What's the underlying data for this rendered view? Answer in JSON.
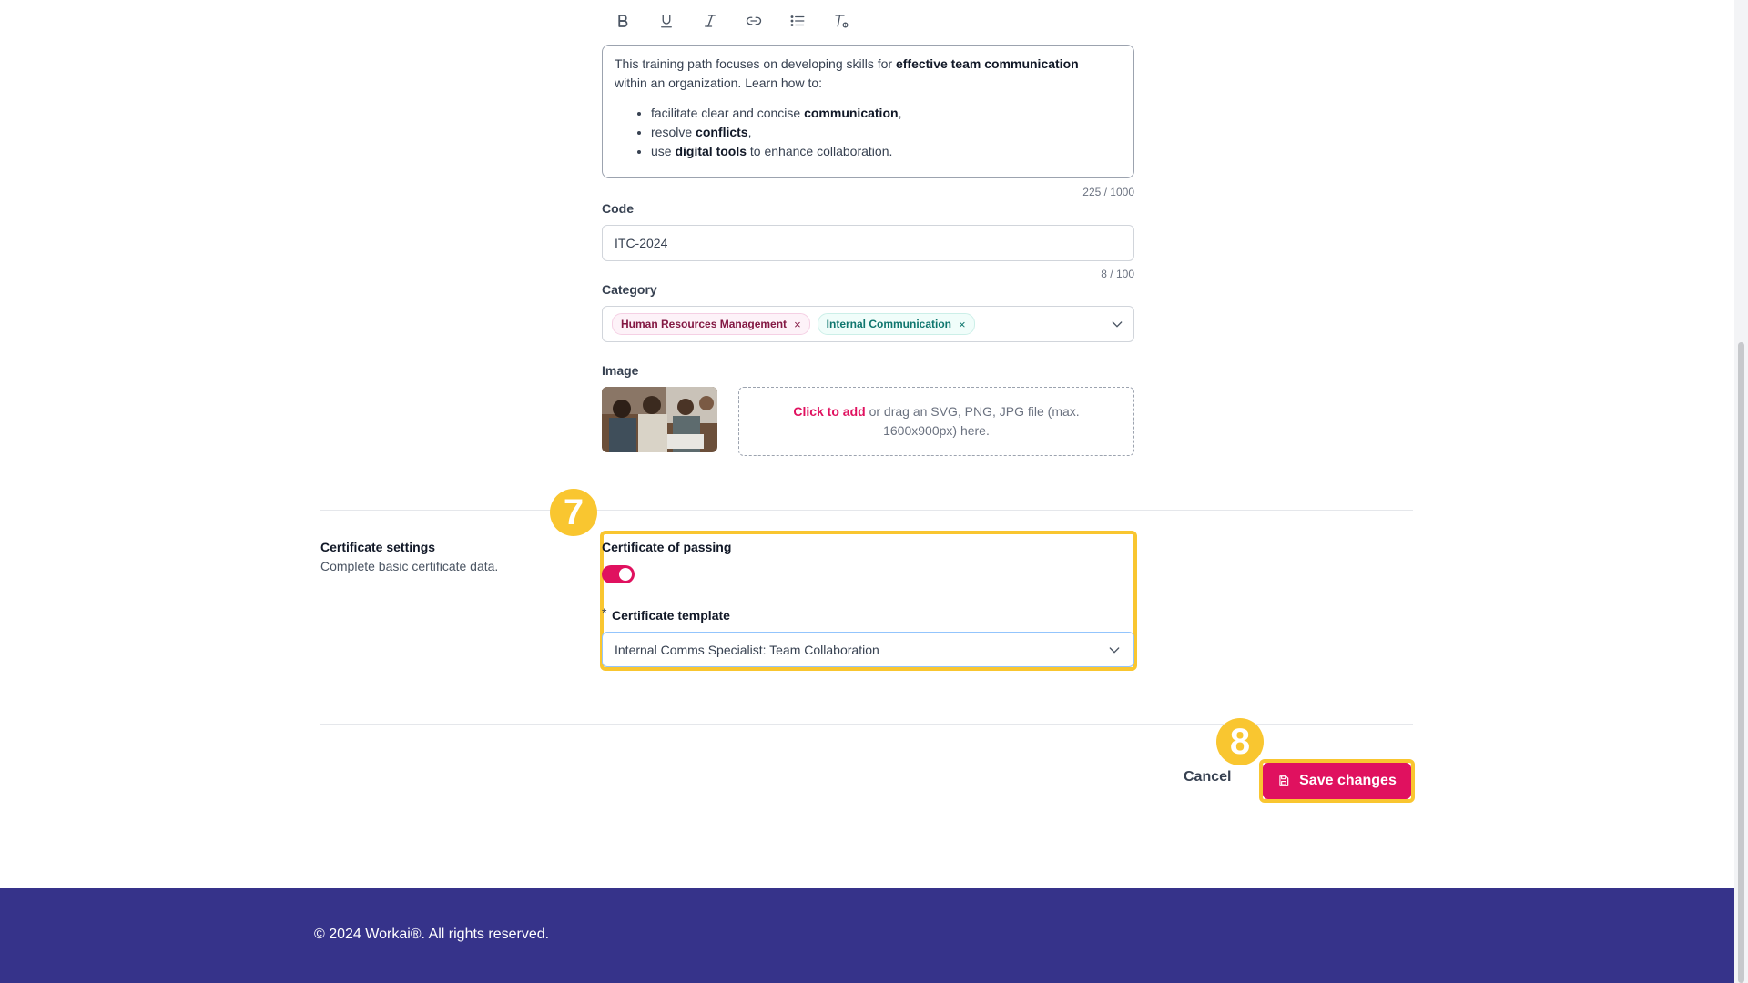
{
  "toolbar": {
    "buttons": [
      "bold-icon",
      "underline-icon",
      "italic-icon",
      "link-icon",
      "bullet-list-icon",
      "clear-format-icon"
    ]
  },
  "description": {
    "intro_1": "This training path focuses on developing skills for ",
    "intro_bold": "effective team communication",
    "intro_2": "within an organization. Learn how to:",
    "bullets": [
      {
        "pre": "facilitate clear and concise ",
        "bold": "communication",
        "post": ","
      },
      {
        "pre": "resolve ",
        "bold": "conflicts",
        "post": ","
      },
      {
        "pre": "use ",
        "bold": "digital tools",
        "post": " to enhance collaboration."
      }
    ],
    "counter": "225 / 1000"
  },
  "code": {
    "label": "Code",
    "value": "ITC-2024",
    "counter": "8 / 100"
  },
  "category": {
    "label": "Category",
    "tags": [
      "Human Resources Management",
      "Internal Communication"
    ],
    "remove_glyph": "×"
  },
  "image": {
    "label": "Image",
    "dropzone_link": "Click to add",
    "dropzone_text": " or drag an SVG, PNG, JPG file (max. 1600x900px) here."
  },
  "certificate_section": {
    "title": "Certificate settings",
    "subtitle": "Complete basic certificate data.",
    "passing_label": "Certificate of passing",
    "passing_enabled": true,
    "template_required_mark": "*",
    "template_label": "Certificate template",
    "template_value": "Internal Comms Specialist: Team Collaboration"
  },
  "steps": {
    "step7": "7",
    "step8": "8"
  },
  "actions": {
    "cancel_label": "Cancel",
    "save_label": "Save changes"
  },
  "footer": {
    "text": "© 2024 Workai®. All rights reserved."
  },
  "colors": {
    "accent": "#e0115f",
    "highlight": "#f9c630",
    "footer_bg": "#36338a"
  }
}
